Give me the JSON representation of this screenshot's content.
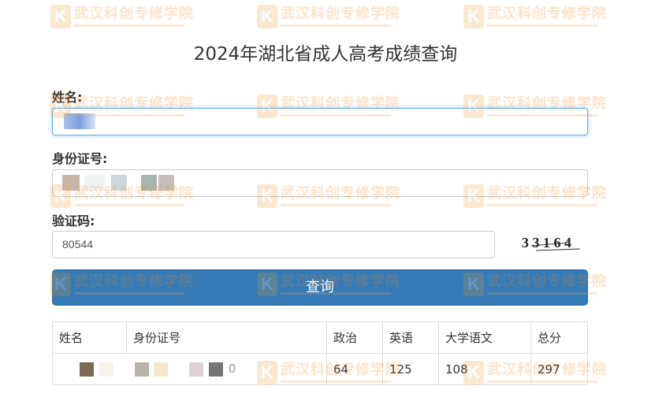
{
  "page": {
    "title": "2024年湖北省成人高考成绩查询"
  },
  "watermark": {
    "logo_letter": "K",
    "text": "武汉科创专修学院"
  },
  "form": {
    "name_label": "姓名:",
    "name_value": "",
    "id_label": "身份证号:",
    "id_value": "",
    "captcha_label": "验证码:",
    "captcha_value": "80544",
    "captcha_image_text": "3 3 1 6 4"
  },
  "query_button": {
    "label": "查询"
  },
  "results_table": {
    "headers": [
      "姓名",
      "身份证号",
      "政治",
      "英语",
      "大学语文",
      "总分"
    ],
    "rows": [
      {
        "name": "",
        "id_number_tail": "0",
        "politics": "64",
        "english": "125",
        "chinese": "108",
        "total": "297"
      }
    ]
  },
  "colors": {
    "primary_button": "#337ab7",
    "focus_border": "#66afe9",
    "watermark": "#f08a1a"
  }
}
